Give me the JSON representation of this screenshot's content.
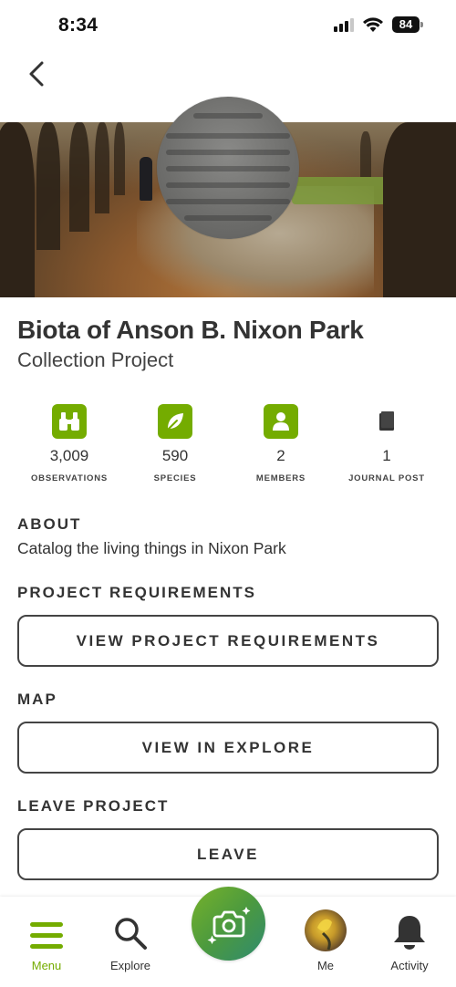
{
  "status_bar": {
    "time": "8:34",
    "battery": "84"
  },
  "project": {
    "title": "Biota of Anson B. Nixon Park",
    "type": "Collection Project"
  },
  "stats": [
    {
      "icon": "binoculars-icon",
      "count": "3,009",
      "label": "OBSERVATIONS"
    },
    {
      "icon": "leaf-icon",
      "count": "590",
      "label": "SPECIES"
    },
    {
      "icon": "person-icon",
      "count": "2",
      "label": "MEMBERS"
    },
    {
      "icon": "book-icon",
      "count": "1",
      "label": "JOURNAL POST"
    }
  ],
  "about": {
    "heading": "ABOUT",
    "text": "Catalog the living things in Nixon Park"
  },
  "requirements": {
    "heading": "PROJECT REQUIREMENTS",
    "button": "VIEW PROJECT REQUIREMENTS"
  },
  "map": {
    "heading": "MAP",
    "button": "VIEW IN EXPLORE"
  },
  "leave": {
    "heading": "LEAVE PROJECT",
    "button": "LEAVE"
  },
  "nav": {
    "menu": "Menu",
    "explore": "Explore",
    "me": "Me",
    "activity": "Activity"
  },
  "colors": {
    "accent": "#74ac00",
    "text": "#333333"
  }
}
